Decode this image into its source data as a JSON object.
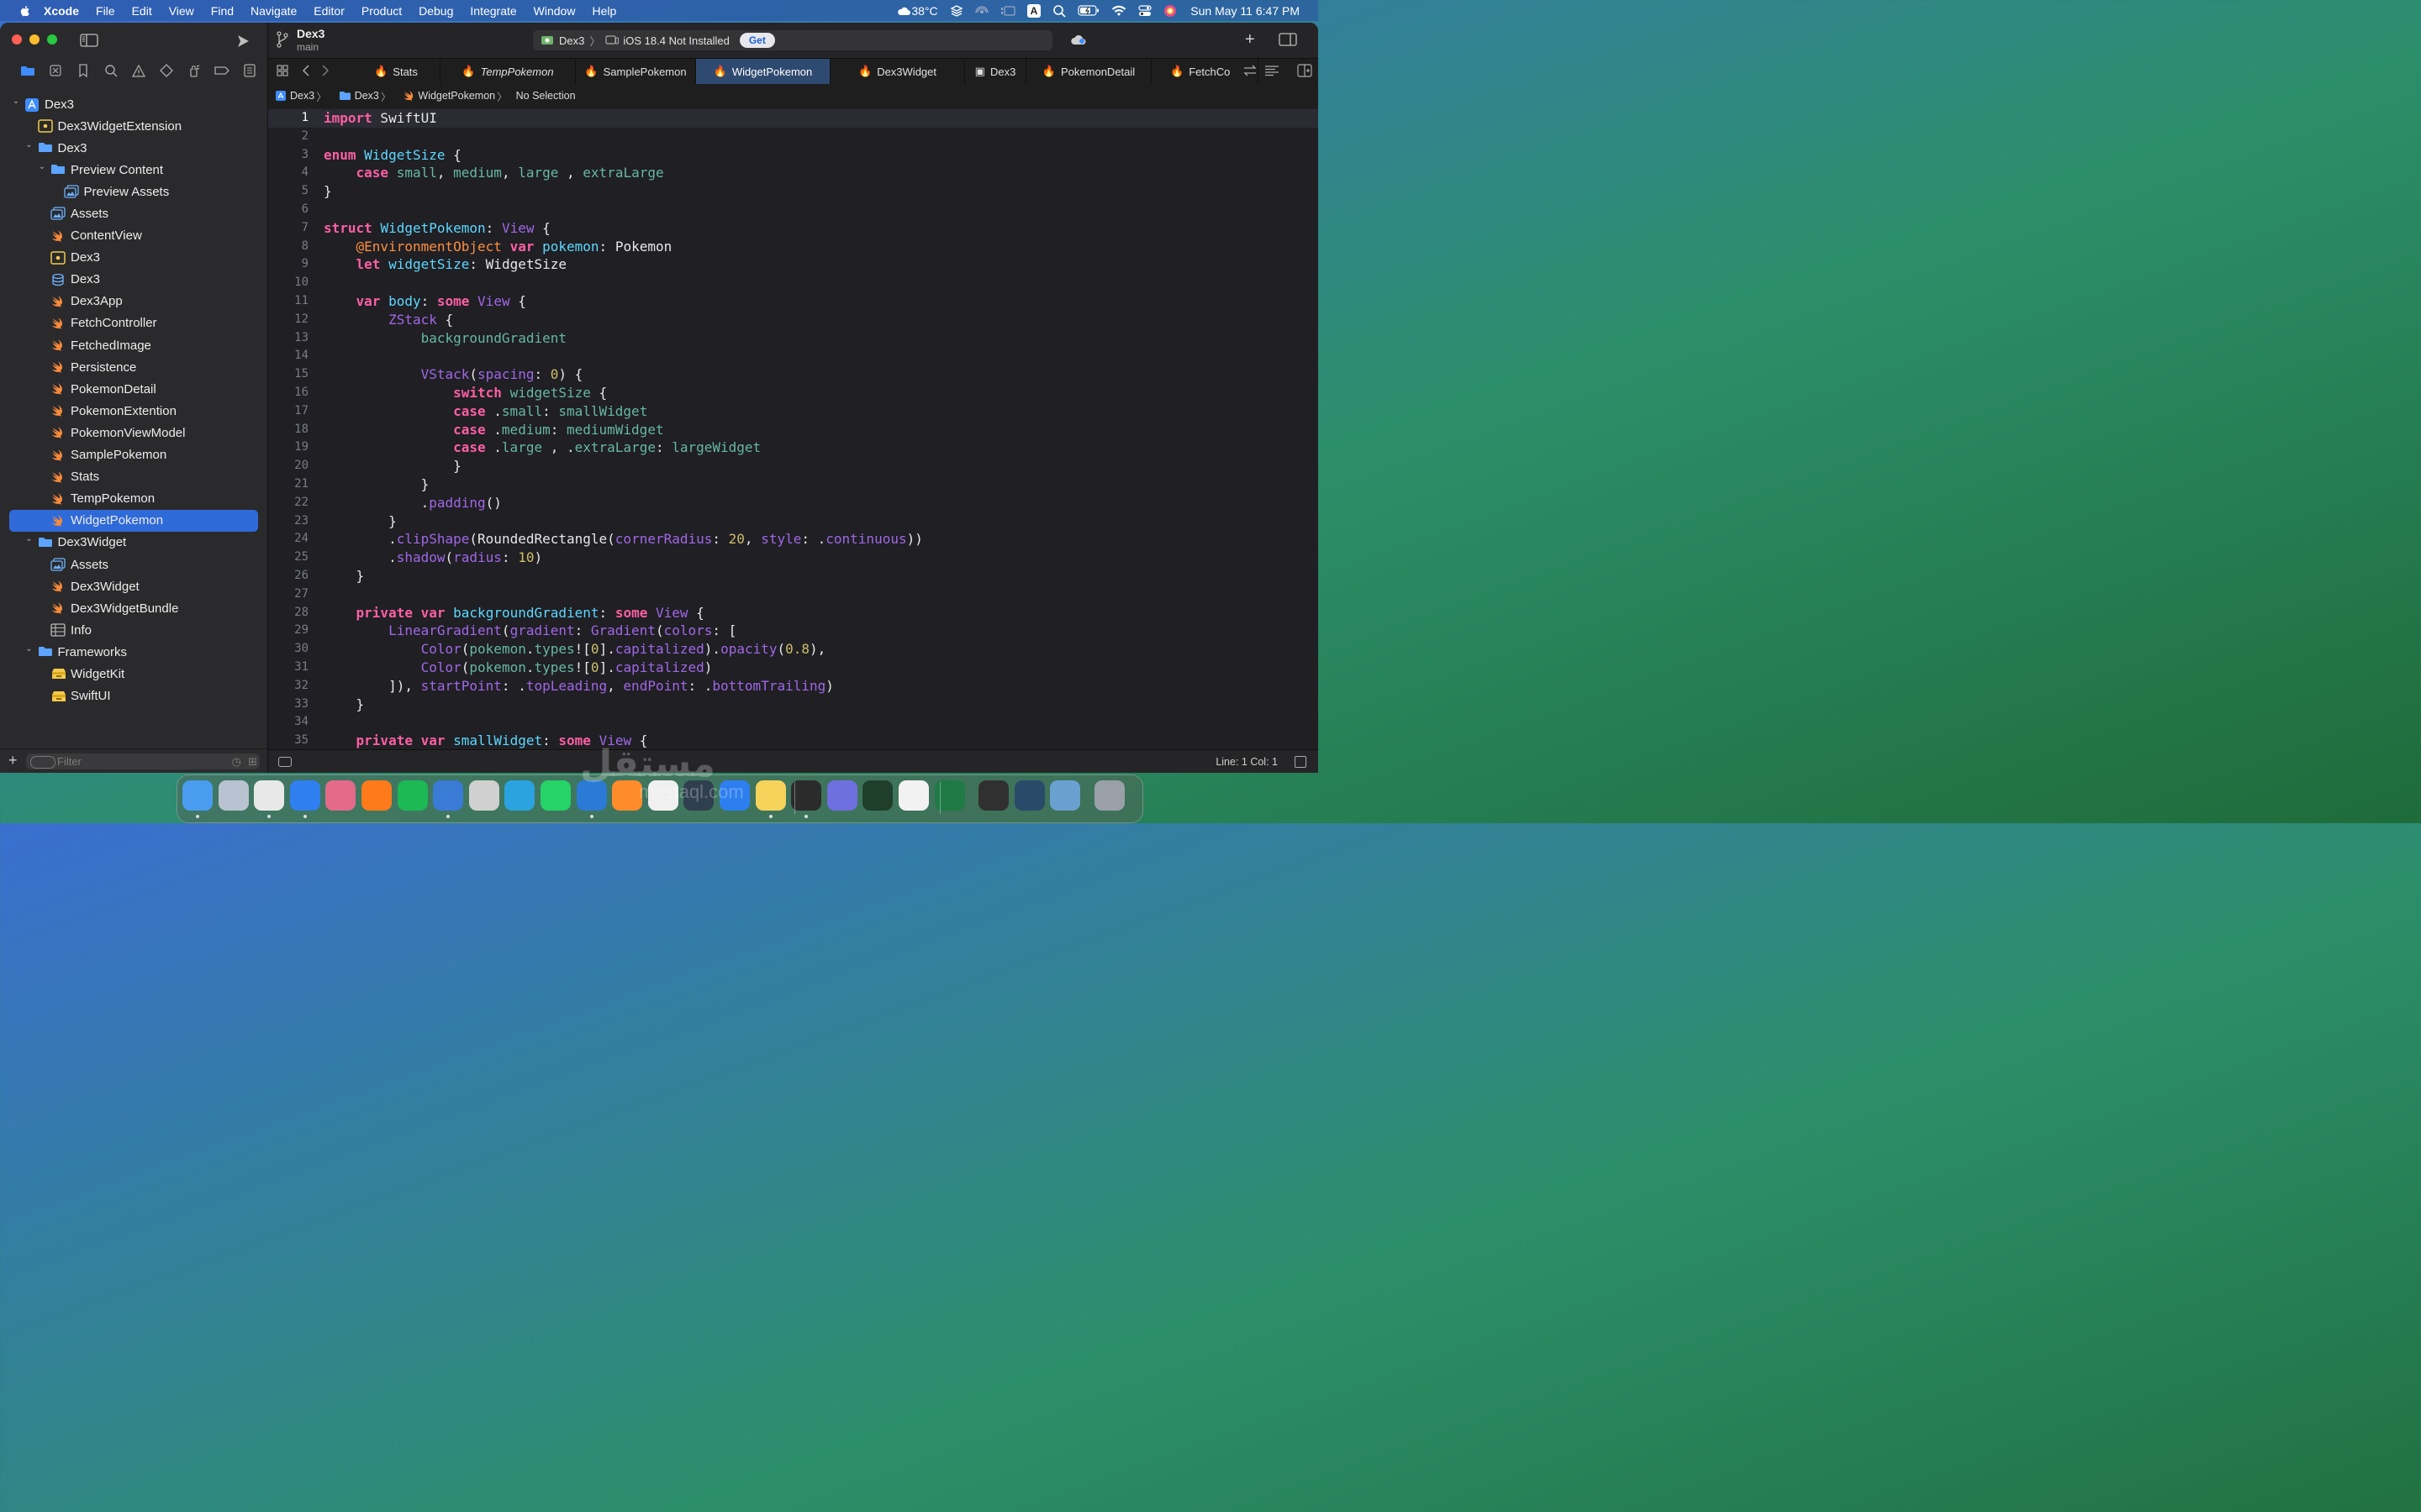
{
  "menubar": {
    "app": "Xcode",
    "items": [
      "File",
      "Edit",
      "View",
      "Find",
      "Navigate",
      "Editor",
      "Product",
      "Debug",
      "Integrate",
      "Window",
      "Help"
    ],
    "weather": "38°C",
    "input_badge": "A",
    "datetime": "Sun May 11  6:47 PM"
  },
  "toolbar": {
    "project": "Dex3",
    "branch": "main",
    "scheme": "Dex3",
    "destination": "iOS 18.4 Not Installed",
    "get_label": "Get"
  },
  "tabs": [
    {
      "label": "Stats"
    },
    {
      "label": "TempPokemon",
      "italic": true
    },
    {
      "label": "SamplePokemon"
    },
    {
      "label": "WidgetPokemon",
      "active": true
    },
    {
      "label": "Dex3Widget"
    },
    {
      "label": "Dex3"
    },
    {
      "label": "PokemonDetail"
    },
    {
      "label": "FetchCo"
    }
  ],
  "jumpbar": [
    "Dex3",
    "Dex3",
    "WidgetPokemon",
    "No Selection"
  ],
  "navigator": {
    "items": [
      {
        "label": "Dex3",
        "level": 0,
        "disclosure": "open",
        "icon": "xcode-project-icon"
      },
      {
        "label": "Dex3WidgetExtension",
        "level": 1,
        "icon": "app-extension-icon"
      },
      {
        "label": "Dex3",
        "level": 1,
        "disclosure": "open",
        "icon": "folder-icon"
      },
      {
        "label": "Preview Content",
        "level": 2,
        "disclosure": "open",
        "icon": "folder-icon"
      },
      {
        "label": "Preview Assets",
        "level": 3,
        "icon": "asset-catalog-icon"
      },
      {
        "label": "Assets",
        "level": 2,
        "icon": "asset-catalog-icon"
      },
      {
        "label": "ContentView",
        "level": 2,
        "icon": "swift-file-icon"
      },
      {
        "label": "Dex3",
        "level": 2,
        "icon": "entitlements-icon"
      },
      {
        "label": "Dex3",
        "level": 2,
        "icon": "data-model-icon"
      },
      {
        "label": "Dex3App",
        "level": 2,
        "icon": "swift-file-icon"
      },
      {
        "label": "FetchController",
        "level": 2,
        "icon": "swift-file-icon"
      },
      {
        "label": "FetchedImage",
        "level": 2,
        "icon": "swift-file-icon"
      },
      {
        "label": "Persistence",
        "level": 2,
        "icon": "swift-file-icon"
      },
      {
        "label": "PokemonDetail",
        "level": 2,
        "icon": "swift-file-icon"
      },
      {
        "label": "PokemonExtention",
        "level": 2,
        "icon": "swift-file-icon"
      },
      {
        "label": "PokemonViewModel",
        "level": 2,
        "icon": "swift-file-icon"
      },
      {
        "label": "SamplePokemon",
        "level": 2,
        "icon": "swift-file-icon"
      },
      {
        "label": "Stats",
        "level": 2,
        "icon": "swift-file-icon"
      },
      {
        "label": "TempPokemon",
        "level": 2,
        "icon": "swift-file-icon"
      },
      {
        "label": "WidgetPokemon",
        "level": 2,
        "icon": "swift-file-icon",
        "selected": true
      },
      {
        "label": "Dex3Widget",
        "level": 1,
        "disclosure": "open",
        "icon": "folder-icon"
      },
      {
        "label": "Assets",
        "level": 2,
        "icon": "asset-catalog-icon"
      },
      {
        "label": "Dex3Widget",
        "level": 2,
        "icon": "swift-file-icon"
      },
      {
        "label": "Dex3WidgetBundle",
        "level": 2,
        "icon": "swift-file-icon"
      },
      {
        "label": "Info",
        "level": 2,
        "icon": "plist-icon"
      },
      {
        "label": "Frameworks",
        "level": 1,
        "disclosure": "open",
        "icon": "folder-icon"
      },
      {
        "label": "WidgetKit",
        "level": 2,
        "icon": "framework-icon"
      },
      {
        "label": "SwiftUI",
        "level": 2,
        "icon": "framework-icon"
      }
    ],
    "filter_placeholder": "Filter"
  },
  "editor": {
    "current_line": 1,
    "lines": [
      [
        [
          "kw",
          "import"
        ],
        [
          "pl",
          " SwiftUI"
        ]
      ],
      [],
      [
        [
          "kw",
          "enum"
        ],
        [
          "pl",
          " "
        ],
        [
          "ty",
          "WidgetSize"
        ],
        [
          "pl",
          " {"
        ]
      ],
      [
        [
          "pl",
          "    "
        ],
        [
          "kw",
          "case"
        ],
        [
          "pl",
          " "
        ],
        [
          "pr",
          "small"
        ],
        [
          "pl",
          ", "
        ],
        [
          "pr",
          "medium"
        ],
        [
          "pl",
          ", "
        ],
        [
          "pr",
          "large"
        ],
        [
          "pl",
          " , "
        ],
        [
          "pr",
          "extraLarge"
        ]
      ],
      [
        [
          "pl",
          "}"
        ]
      ],
      [],
      [
        [
          "kw",
          "struct"
        ],
        [
          "pl",
          " "
        ],
        [
          "ty",
          "WidgetPokemon"
        ],
        [
          "pl",
          ": "
        ],
        [
          "ca",
          "View"
        ],
        [
          "pl",
          " {"
        ]
      ],
      [
        [
          "pl",
          "    "
        ],
        [
          "at",
          "@EnvironmentObject"
        ],
        [
          "pl",
          " "
        ],
        [
          "kw",
          "var"
        ],
        [
          "pl",
          " "
        ],
        [
          "ty",
          "pokemon"
        ],
        [
          "pl",
          ": Pokemon"
        ]
      ],
      [
        [
          "pl",
          "    "
        ],
        [
          "kw",
          "let"
        ],
        [
          "pl",
          " "
        ],
        [
          "ty",
          "widgetSize"
        ],
        [
          "pl",
          ": WidgetSize"
        ]
      ],
      [],
      [
        [
          "pl",
          "    "
        ],
        [
          "kw",
          "var"
        ],
        [
          "pl",
          " "
        ],
        [
          "ty",
          "body"
        ],
        [
          "pl",
          ": "
        ],
        [
          "kw",
          "some"
        ],
        [
          "pl",
          " "
        ],
        [
          "ca",
          "View"
        ],
        [
          "pl",
          " {"
        ]
      ],
      [
        [
          "pl",
          "        "
        ],
        [
          "ca",
          "ZStack"
        ],
        [
          "pl",
          " {"
        ]
      ],
      [
        [
          "pl",
          "            "
        ],
        [
          "pr",
          "backgroundGradient"
        ]
      ],
      [],
      [
        [
          "pl",
          "            "
        ],
        [
          "ca",
          "VStack"
        ],
        [
          "pl",
          "("
        ],
        [
          "ca",
          "spacing"
        ],
        [
          "pl",
          ": "
        ],
        [
          "nm",
          "0"
        ],
        [
          "pl",
          ") {"
        ]
      ],
      [
        [
          "pl",
          "                "
        ],
        [
          "kw",
          "switch"
        ],
        [
          "pl",
          " "
        ],
        [
          "pr",
          "widgetSize"
        ],
        [
          "pl",
          " {"
        ]
      ],
      [
        [
          "pl",
          "                "
        ],
        [
          "kw",
          "case"
        ],
        [
          "pl",
          " ."
        ],
        [
          "pr",
          "small"
        ],
        [
          "pl",
          ": "
        ],
        [
          "pr",
          "smallWidget"
        ]
      ],
      [
        [
          "pl",
          "                "
        ],
        [
          "kw",
          "case"
        ],
        [
          "pl",
          " ."
        ],
        [
          "pr",
          "medium"
        ],
        [
          "pl",
          ": "
        ],
        [
          "pr",
          "mediumWidget"
        ]
      ],
      [
        [
          "pl",
          "                "
        ],
        [
          "kw",
          "case"
        ],
        [
          "pl",
          " ."
        ],
        [
          "pr",
          "large"
        ],
        [
          "pl",
          " , ."
        ],
        [
          "pr",
          "extraLarge"
        ],
        [
          "pl",
          ": "
        ],
        [
          "pr",
          "largeWidget"
        ]
      ],
      [
        [
          "pl",
          "                }"
        ]
      ],
      [
        [
          "pl",
          "            }"
        ]
      ],
      [
        [
          "pl",
          "            ."
        ],
        [
          "ca",
          "padding"
        ],
        [
          "pl",
          "()"
        ]
      ],
      [
        [
          "pl",
          "        }"
        ]
      ],
      [
        [
          "pl",
          "        ."
        ],
        [
          "ca",
          "clipShape"
        ],
        [
          "pl",
          "(RoundedRectangle("
        ],
        [
          "ca",
          "cornerRadius"
        ],
        [
          "pl",
          ": "
        ],
        [
          "nm",
          "20"
        ],
        [
          "pl",
          ", "
        ],
        [
          "ca",
          "style"
        ],
        [
          "pl",
          ": ."
        ],
        [
          "ca",
          "continuous"
        ],
        [
          "pl",
          "))"
        ]
      ],
      [
        [
          "pl",
          "        ."
        ],
        [
          "ca",
          "shadow"
        ],
        [
          "pl",
          "("
        ],
        [
          "ca",
          "radius"
        ],
        [
          "pl",
          ": "
        ],
        [
          "nm",
          "10"
        ],
        [
          "pl",
          ")"
        ]
      ],
      [
        [
          "pl",
          "    }"
        ]
      ],
      [],
      [
        [
          "pl",
          "    "
        ],
        [
          "kw",
          "private"
        ],
        [
          "pl",
          " "
        ],
        [
          "kw",
          "var"
        ],
        [
          "pl",
          " "
        ],
        [
          "ty",
          "backgroundGradient"
        ],
        [
          "pl",
          ": "
        ],
        [
          "kw",
          "some"
        ],
        [
          "pl",
          " "
        ],
        [
          "ca",
          "View"
        ],
        [
          "pl",
          " {"
        ]
      ],
      [
        [
          "pl",
          "        "
        ],
        [
          "ca",
          "LinearGradient"
        ],
        [
          "pl",
          "("
        ],
        [
          "ca",
          "gradient"
        ],
        [
          "pl",
          ": "
        ],
        [
          "ca",
          "Gradient"
        ],
        [
          "pl",
          "("
        ],
        [
          "ca",
          "colors"
        ],
        [
          "pl",
          ": ["
        ]
      ],
      [
        [
          "pl",
          "            "
        ],
        [
          "ca",
          "Color"
        ],
        [
          "pl",
          "("
        ],
        [
          "pr",
          "pokemon"
        ],
        [
          "pl",
          "."
        ],
        [
          "pr",
          "types"
        ],
        [
          "pl",
          "!["
        ],
        [
          "nm",
          "0"
        ],
        [
          "pl",
          "]."
        ],
        [
          "ca",
          "capitalized"
        ],
        [
          "pl",
          ")."
        ],
        [
          "ca",
          "opacity"
        ],
        [
          "pl",
          "("
        ],
        [
          "nm",
          "0.8"
        ],
        [
          "pl",
          "),"
        ]
      ],
      [
        [
          "pl",
          "            "
        ],
        [
          "ca",
          "Color"
        ],
        [
          "pl",
          "("
        ],
        [
          "pr",
          "pokemon"
        ],
        [
          "pl",
          "."
        ],
        [
          "pr",
          "types"
        ],
        [
          "pl",
          "!["
        ],
        [
          "nm",
          "0"
        ],
        [
          "pl",
          "]."
        ],
        [
          "ca",
          "capitalized"
        ],
        [
          "pl",
          ")"
        ]
      ],
      [
        [
          "pl",
          "        ]), "
        ],
        [
          "ca",
          "startPoint"
        ],
        [
          "pl",
          ": ."
        ],
        [
          "ca",
          "topLeading"
        ],
        [
          "pl",
          ", "
        ],
        [
          "ca",
          "endPoint"
        ],
        [
          "pl",
          ": ."
        ],
        [
          "ca",
          "bottomTrailing"
        ],
        [
          "pl",
          ")"
        ]
      ],
      [
        [
          "pl",
          "    }"
        ]
      ],
      [],
      [
        [
          "pl",
          "    "
        ],
        [
          "kw",
          "private"
        ],
        [
          "pl",
          " "
        ],
        [
          "kw",
          "var"
        ],
        [
          "pl",
          " "
        ],
        [
          "ty",
          "smallWidget"
        ],
        [
          "pl",
          ": "
        ],
        [
          "kw",
          "some"
        ],
        [
          "pl",
          " "
        ],
        [
          "ca",
          "View"
        ],
        [
          "pl",
          " {"
        ]
      ]
    ]
  },
  "statusbar": {
    "position": "Line: 1  Col: 1"
  },
  "dock": {
    "apps": [
      "Finder",
      "Launchpad",
      "Chrome",
      "Safari",
      "Pixelmator",
      "Firefox",
      "Spotify",
      "Xcode",
      "Instruments",
      "Telegram",
      "WhatsApp",
      "VS Code",
      "Sublime",
      "ChatGPT",
      "Network",
      "App Store",
      "Notes",
      "Terminal",
      "Dash",
      "Activity",
      "TextEdit",
      "Excel",
      "Unity",
      "QuickTime",
      "Preview",
      "Trash"
    ]
  },
  "watermark": {
    "text": "مستقل",
    "sub": "mostaql.com"
  },
  "colors": {
    "selection": "#2f6ad9",
    "keyword": "#fc5fa3",
    "type": "#5dd8ff",
    "property": "#67b7a4",
    "call": "#a167e6",
    "number": "#d0bf69",
    "attribute": "#fd8f3f"
  }
}
